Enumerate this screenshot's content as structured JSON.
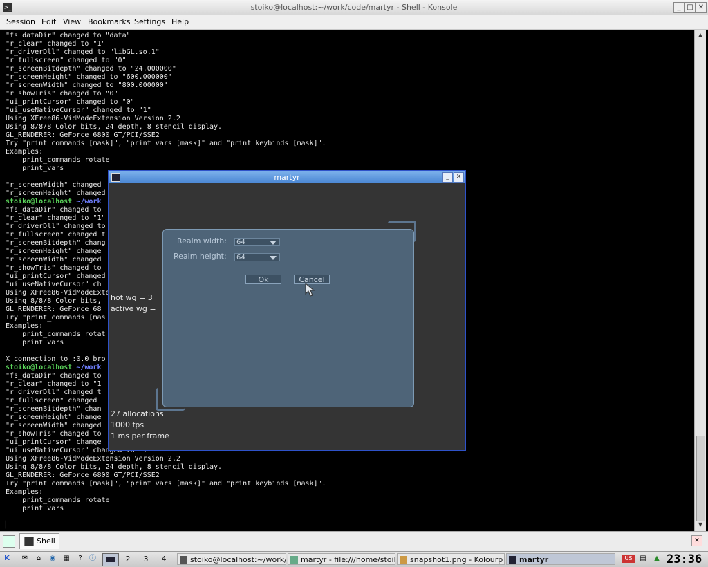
{
  "konsole": {
    "title": "stoiko@localhost:~/work/code/martyr - Shell - Konsole",
    "menu": [
      "Session",
      "Edit",
      "View",
      "Bookmarks",
      "Settings",
      "Help"
    ],
    "terminal_lines": [
      "\"fs_dataDir\" changed to \"data\"",
      "\"r_clear\" changed to \"1\"",
      "\"r_driverDll\" changed to \"libGL.so.1\"",
      "\"r_fullscreen\" changed to \"0\"",
      "\"r_screenBitdepth\" changed to \"24.000000\"",
      "\"r_screenHeight\" changed to \"600.000000\"",
      "\"r_screenWidth\" changed to \"800.000000\"",
      "\"r_showTris\" changed to \"0\"",
      "\"ui_printCursor\" changed to \"0\"",
      "\"ui_useNativeCursor\" changed to \"1\"",
      "Using XFree86-VidModeExtension Version 2.2",
      "Using 8/8/8 Color bits, 24 depth, 8 stencil display.",
      "GL_RENDERER: GeForce 6800 GT/PCI/SSE2",
      "Try \"print_commands [mask]\", \"print_vars [mask]\" and \"print_keybinds [mask]\".",
      "Examples:",
      "    print_commands rotate",
      "    print_vars",
      "",
      "\"r_screenWidth\" changed",
      "\"r_screenHeight\" changed",
      "[[PROMPT]]",
      "\"fs_dataDir\" changed to",
      "\"r_clear\" changed to \"1\"",
      "\"r_driverDll\" changed to",
      "\"r_fullscreen\" changed t",
      "\"r_screenBitdepth\" chang",
      "\"r_screenHeight\" change",
      "\"r_screenWidth\" changed",
      "\"r_showTris\" changed to",
      "\"ui_printCursor\" changed",
      "\"ui_useNativeCursor\" ch",
      "Using XFree86-VidModeExte",
      "Using 8/8/8 Color bits,",
      "GL_RENDERER: GeForce 68",
      "Try \"print_commands [mas",
      "Examples:",
      "    print_commands rotat",
      "    print_vars",
      "",
      "X connection to :0.0 bro",
      "[[PROMPT]]",
      "\"fs_dataDir\" changed to",
      "\"r_clear\" changed to \"1",
      "\"r_driverDll\" changed t",
      "\"r_fullscreen\" changed",
      "\"r_screenBitdepth\" chan",
      "\"r_screenHeight\" change",
      "\"r_screenWidth\" changed",
      "\"r_showTris\" changed to",
      "\"ui_printCursor\" change",
      "\"ui_useNativeCursor\" changed to \"1\"",
      "Using XFree86-VidModeExtension Version 2.2",
      "Using 8/8/8 Color bits, 24 depth, 8 stencil display.",
      "GL_RENDERER: GeForce 6800 GT/PCI/SSE2",
      "Try \"print_commands [mask]\", \"print_vars [mask]\" and \"print_keybinds [mask]\".",
      "Examples:",
      "    print_commands rotate",
      "    print_vars",
      "",
      "▏"
    ],
    "prompt_user": "stoiko@localhost",
    "prompt_path": " ~/work",
    "tab_label": "Shell"
  },
  "martyr": {
    "title": "martyr",
    "realm_width_label": "Realm width:",
    "realm_width_value": "64",
    "realm_height_label": "Realm height:",
    "realm_height_value": "64",
    "ok_label": "Ok",
    "cancel_label": "Cancel",
    "hot_wg": "hot wg = 3",
    "active_wg": "active wg = ",
    "allocations": "27 allocations",
    "fps": "1000 fps",
    "ms_per_frame": "1 ms per frame"
  },
  "taskbar": {
    "desktops": [
      "2",
      "3",
      "4"
    ],
    "tasks": [
      "stoiko@localhost:~/work/c",
      "martyr - file:///home/stoik",
      "snapshot1.png - Kolourp",
      "martyr"
    ],
    "clock": "23:36",
    "keyboard": "US"
  },
  "colors": {
    "terminal_bg": "#000000",
    "terminal_fg": "#e8e8e8",
    "prompt_green": "#5ad35a",
    "prompt_blue": "#6f7fff",
    "martyr_panel": "#4e6478",
    "martyr_titlebar": "#4a86d4"
  }
}
